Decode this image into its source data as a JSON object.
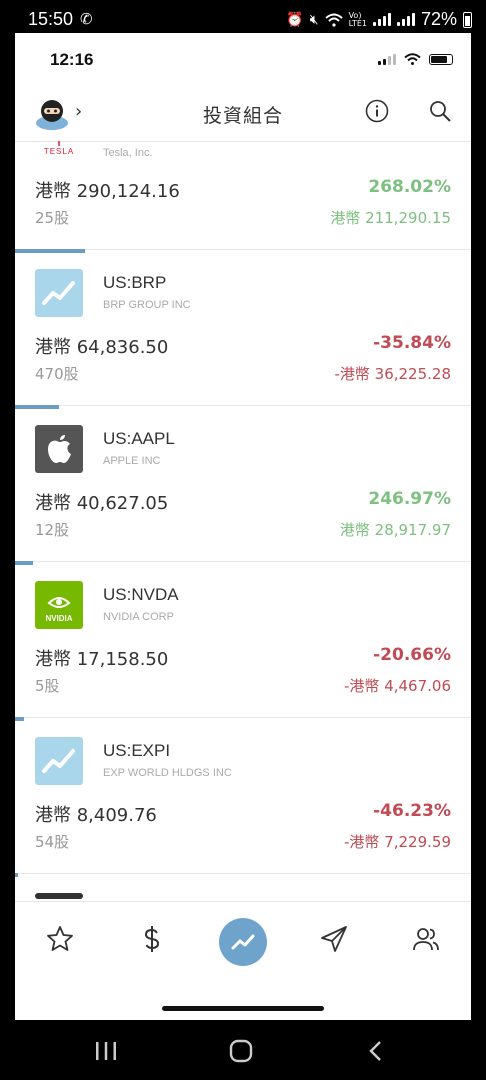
{
  "system_bar": {
    "time": "15:50",
    "battery": "72%",
    "icons": [
      "phone-icon",
      "alarm-icon",
      "mute-icon",
      "wifi-icon",
      "volte-icon",
      "signal-icon",
      "signal-icon",
      "battery-icon"
    ]
  },
  "ios_bar": {
    "time": "12:16"
  },
  "header": {
    "title": "投資組合"
  },
  "holdings": [
    {
      "ticker": "",
      "company": "Tesla, Inc.",
      "brand": "TESLA",
      "value": "港幣 290,124.16",
      "quantity": "25股",
      "pct": "268.02%",
      "gain": "港幣 211,290.15",
      "positive": true,
      "weight": 0.0
    },
    {
      "ticker": "US:BRP",
      "company": "BRP GROUP INC",
      "value": "港幣 64,836.50",
      "quantity": "470股",
      "pct": "-35.84%",
      "gain": "-港幣 36,225.28",
      "positive": false,
      "weight": 0.15
    },
    {
      "ticker": "US:AAPL",
      "company": "APPLE INC",
      "value": "港幣 40,627.05",
      "quantity": "12股",
      "pct": "246.97%",
      "gain": "港幣 28,917.97",
      "positive": true,
      "weight": 0.095
    },
    {
      "ticker": "US:NVDA",
      "company": "NVIDIA CORP",
      "brand": "NVIDIA",
      "value": "港幣 17,158.50",
      "quantity": "5股",
      "pct": "-20.66%",
      "gain": "-港幣 4,467.06",
      "positive": false,
      "weight": 0.04
    },
    {
      "ticker": "US:EXPI",
      "company": "EXP WORLD HLDGS INC",
      "value": "港幣 8,409.76",
      "quantity": "54股",
      "pct": "-46.23%",
      "gain": "-港幣 7,229.59",
      "positive": false,
      "weight": 0.02
    }
  ],
  "nav": {
    "items": [
      "star-icon",
      "dollar-icon",
      "trend-icon",
      "send-icon",
      "people-icon"
    ],
    "active": "trend-icon"
  },
  "colors": {
    "accent": "#6ea3cc",
    "positive": "#7dc07f",
    "negative": "#c04b54",
    "progress": "#6b9cc2"
  }
}
